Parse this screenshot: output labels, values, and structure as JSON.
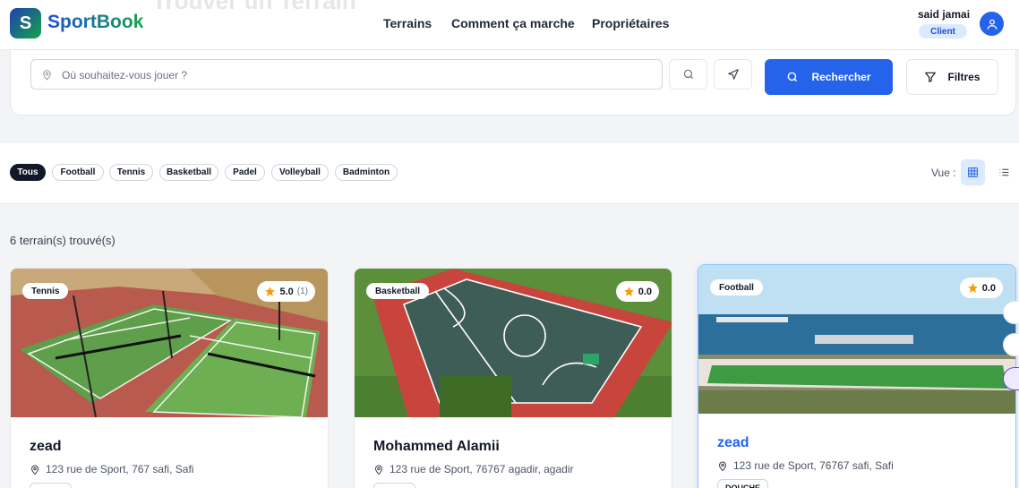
{
  "header": {
    "ghost_title": "Trouver un Terrain",
    "logo_letter": "S",
    "brand": "SportBook",
    "nav": [
      "Terrains",
      "Comment ça marche",
      "Propriétaires"
    ],
    "user_name": "said jamai",
    "user_role": "Client"
  },
  "search": {
    "placeholder": "Où souhaitez-vous jouer ?",
    "search_button": "Rechercher",
    "filter_button": "Filtres"
  },
  "filters": {
    "chips": [
      "Tous",
      "Football",
      "Tennis",
      "Basketball",
      "Padel",
      "Volleyball",
      "Badminton"
    ],
    "active": "Tous",
    "view_label": "Vue :"
  },
  "results": {
    "count_text": "6 terrain(s) trouvé(s)",
    "cards": [
      {
        "sport": "Tennis",
        "rating": "5.0",
        "rating_count": "(1)",
        "title": "zead",
        "address": "123 rue de Sport, 767 safi, Safi",
        "amenity": ""
      },
      {
        "sport": "Basketball",
        "rating": "0.0",
        "rating_count": "",
        "title": "Mohammed Alamii",
        "address": "123 rue de Sport, 76767 agadir, agadir",
        "amenity": ""
      },
      {
        "sport": "Football",
        "rating": "0.0",
        "rating_count": "",
        "title": "zead",
        "address": "123 rue de Sport, 76767 safi, Safi",
        "amenity": "DOUCHE"
      }
    ]
  },
  "colors": {
    "primary": "#2563eb",
    "brand_green": "#16a34a",
    "star": "#f59e0b",
    "active_chip": "#111827"
  }
}
